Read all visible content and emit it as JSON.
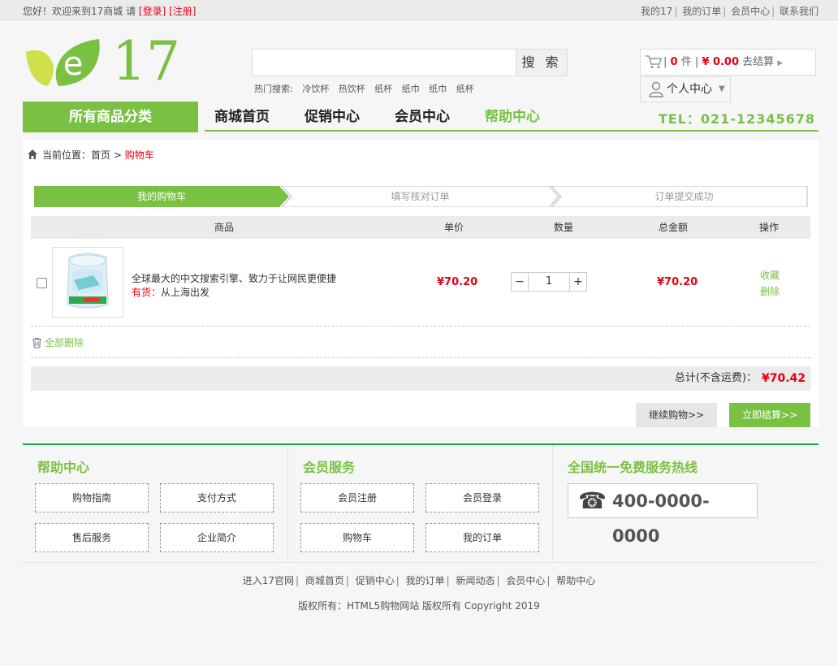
{
  "topbar": {
    "greeting": "您好！欢迎来到17商城 请",
    "login": "[登录]",
    "register": "[注册]",
    "links": [
      "我的17",
      "我的订单",
      "会员中心",
      "联系我们"
    ]
  },
  "header": {
    "logo_letter": "e",
    "logo_number": "17",
    "search_placeholder": "",
    "search_button": "搜 索",
    "hot_label": "热门搜索:",
    "hot_words": [
      "冷饮杯",
      "热饮杯",
      "纸杯",
      "纸巾",
      "纸巾",
      "纸杯"
    ],
    "cart": {
      "count": "0",
      "count_unit": "件",
      "amount": "¥ 0.00",
      "checkout": "去结算"
    },
    "user_center": "个人中心"
  },
  "nav": {
    "all_categories": "所有商品分类",
    "items": [
      "商城首页",
      "促销中心",
      "会员中心",
      "帮助中心"
    ],
    "tel": "TEL：021-12345678"
  },
  "breadcrumb": {
    "label": "当前位置：",
    "home": "首页",
    "arrow": ">",
    "current": "购物车"
  },
  "steps": [
    "我的购物车",
    "填写核对订单",
    "订单提交成功"
  ],
  "table": {
    "headers": {
      "product": "商品",
      "price": "单价",
      "qty": "数量",
      "total": "总金额",
      "ops": "操作"
    },
    "rows": [
      {
        "name": "全球最大的中文搜索引擎、致力于让网民更便捷",
        "stock_label": "有货：",
        "stock_text": "从上海出发",
        "price": "¥70.20",
        "qty": "1",
        "total": "¥70.20",
        "fav": "收藏",
        "del": "删除"
      }
    ],
    "qty_minus": "−",
    "qty_plus": "+"
  },
  "delete_all": "全部删除",
  "summary": {
    "label": "总计(不含运费)：",
    "value": "¥70.42"
  },
  "buttons": {
    "continue": "继续购物>>",
    "checkout": "立即结算>>"
  },
  "footer": {
    "help": {
      "title": "帮助中心",
      "items": [
        "购物指南",
        "支付方式",
        "售后服务",
        "企业简介"
      ]
    },
    "member": {
      "title": "会员服务",
      "items": [
        "会员注册",
        "会员登录",
        "购物车",
        "我的订单"
      ]
    },
    "hotline": {
      "title": "全国统一免费服务热线",
      "number": "400-0000-0000"
    },
    "links": [
      "进入17官网",
      "商城首页",
      "促销中心",
      "我的订单",
      "新闻动态",
      "会员中心",
      "帮助中心"
    ],
    "copyright": "版权所有：HTML5购物网站 版权所有 Copyright 2019"
  },
  "colors": {
    "brand_green": "#7ac143",
    "price_red": "#e60012",
    "footer_rule": "#1aa34a"
  }
}
